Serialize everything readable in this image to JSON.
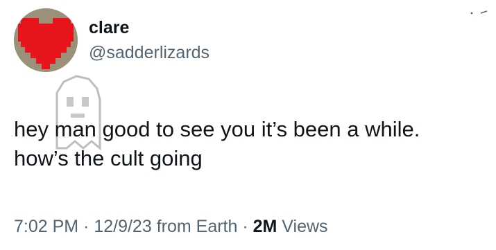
{
  "tweet": {
    "author": {
      "display_name": "clare",
      "handle": "@sadderlizards",
      "avatar_icon": "pixel-heart-icon",
      "avatar_color": "#e8141c"
    },
    "body_lines": [
      "hey man good to see you it’s been a while.",
      "how’s the cult going"
    ],
    "meta": {
      "time": "7:02 PM",
      "sep1": " · ",
      "date": "12/9/23",
      "source": " from Earth",
      "sep2": " · ",
      "views_count": "2M",
      "views_label": " Views"
    },
    "decorations": {
      "ghost_icon": "pixel-ghost-icon",
      "more_icon": "more-options-icon"
    }
  }
}
